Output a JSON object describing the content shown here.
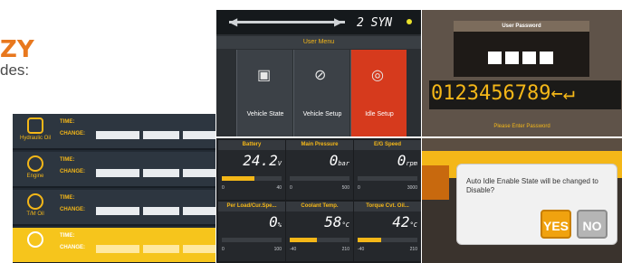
{
  "page": {
    "heading_fragment": "ZY",
    "subtext_fragment": "des:"
  },
  "maintenance_panel": {
    "column_labels": [
      "TIME:",
      "CHANGE:"
    ],
    "rows": [
      {
        "icon": "filter-icon",
        "label": "Hydraulic Oil",
        "selected": false
      },
      {
        "icon": "oil-drop-icon",
        "label": "Engine",
        "selected": false
      },
      {
        "icon": "gear-oil-icon",
        "label": "T/M Oil",
        "selected": false
      },
      {
        "icon": "coolant-icon",
        "label": "",
        "selected": true
      }
    ]
  },
  "user_menu": {
    "brand": "2 SYN",
    "title": "User Menu",
    "tiles": [
      {
        "icon": "vehicle-state-icon",
        "label": "Vehicle State",
        "active": false
      },
      {
        "icon": "vehicle-setup-icon",
        "label": "Vehicle Setup",
        "active": false
      },
      {
        "icon": "idle-setup-icon",
        "label": "Idle Setup",
        "active": true
      }
    ]
  },
  "password_panel": {
    "title": "User Password",
    "digits": "0123456789←↵",
    "hint": "Please Enter Password"
  },
  "gauges": [
    {
      "label": "Battery",
      "value": "24.2",
      "unit": "V",
      "min": "0",
      "max": "40",
      "fill": 0.55
    },
    {
      "label": "Main Pressure",
      "value": "0",
      "unit": "bar",
      "min": "0",
      "max": "500",
      "fill": 0.0
    },
    {
      "label": "E/G Speed",
      "value": "0",
      "unit": "rpm",
      "min": "0",
      "max": "3000",
      "fill": 0.0
    },
    {
      "label": "Per Load/Cur.Spe...",
      "value": "0",
      "unit": "%",
      "min": "0",
      "max": "100",
      "fill": 0.0
    },
    {
      "label": "Coolant Temp.",
      "value": "58",
      "unit": "°C",
      "min": "-40",
      "max": "210",
      "fill": 0.45
    },
    {
      "label": "Torque Cvt. Oil...",
      "value": "42",
      "unit": "°C",
      "min": "-40",
      "max": "210",
      "fill": 0.4
    }
  ],
  "dialog": {
    "message": "Auto Idle Enable State will be changed to Disable?",
    "yes_label": "YES",
    "no_label": "NO"
  },
  "colors": {
    "accent": "#f4b718",
    "heading": "#e8781e",
    "active_tile": "#d63a1d"
  }
}
